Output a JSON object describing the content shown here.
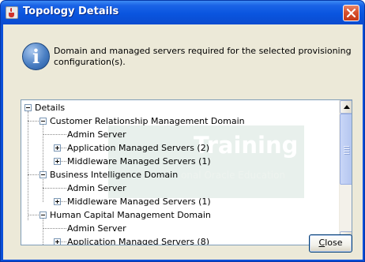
{
  "window": {
    "title": "Topology Details",
    "icon": "java-cup-icon",
    "close_icon": "close-icon"
  },
  "message": {
    "icon": "info-icon",
    "icon_glyph": "i",
    "text": "Domain and managed servers required for the selected provisioning configuration(s)."
  },
  "watermark": {
    "big": "Training",
    "small": "onal Oracle Education"
  },
  "tree": {
    "root": "Details",
    "nodes": [
      {
        "label": "Customer Relationship Management Domain",
        "state": "expanded"
      },
      {
        "label": "Admin Server",
        "state": "leaf"
      },
      {
        "label": "Application Managed Servers (2)",
        "state": "collapsed"
      },
      {
        "label": "Middleware Managed Servers (1)",
        "state": "collapsed"
      },
      {
        "label": "Business Intelligence Domain",
        "state": "expanded"
      },
      {
        "label": "Admin Server",
        "state": "leaf"
      },
      {
        "label": "Middleware Managed Servers (1)",
        "state": "collapsed"
      },
      {
        "label": "Human Capital Management Domain",
        "state": "expanded"
      },
      {
        "label": "Admin Server",
        "state": "leaf"
      },
      {
        "label": "Application Managed Servers (8)",
        "state": "collapsed"
      }
    ]
  },
  "buttons": {
    "close_mnemonic": "C",
    "close_rest": "lose"
  },
  "colors": {
    "titlebar": "#0a55df",
    "dialog_bg": "#ece9d8",
    "border": "#7f9db9",
    "close_red": "#d8512f"
  }
}
